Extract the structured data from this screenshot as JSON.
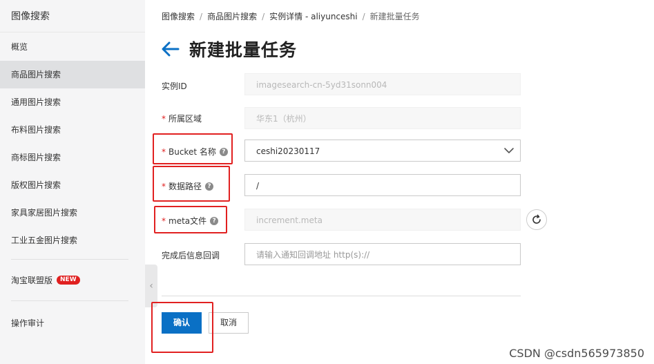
{
  "sidebar": {
    "title": "图像搜索",
    "items": [
      {
        "label": "概览"
      },
      {
        "label": "商品图片搜索"
      },
      {
        "label": "通用图片搜索"
      },
      {
        "label": "布料图片搜索"
      },
      {
        "label": "商标图片搜索"
      },
      {
        "label": "版权图片搜索"
      },
      {
        "label": "家具家居图片搜索"
      },
      {
        "label": "工业五金图片搜索"
      }
    ],
    "taobao": {
      "label": "淘宝联盟版",
      "badge": "NEW"
    },
    "audit": {
      "label": "操作审计"
    },
    "collapse_glyph": "‹"
  },
  "breadcrumb": {
    "items": [
      "图像搜索",
      "商品图片搜索",
      "实例详情 - aliyunceshi",
      "新建批量任务"
    ],
    "separator": "/"
  },
  "page": {
    "title": "新建批量任务"
  },
  "form": {
    "required_mark": "*",
    "help_glyph": "?",
    "instance_id": {
      "label": "实例ID",
      "value": "imagesearch-cn-5yd31sonn004"
    },
    "region": {
      "label": "所属区域",
      "value": "华东1（杭州）"
    },
    "bucket": {
      "label": "Bucket 名称",
      "value": "ceshi20230117"
    },
    "data_path": {
      "label": "数据路径",
      "value": "/"
    },
    "meta_file": {
      "label": "meta文件",
      "value": "increment.meta"
    },
    "callback": {
      "label": "完成后信息回调",
      "placeholder": "请输入通知回调地址 http(s)://"
    }
  },
  "buttons": {
    "confirm": "确认",
    "cancel": "取消"
  },
  "watermark": "CSDN @csdn565973850",
  "colors": {
    "primary": "#0a70c5",
    "highlight": "#e12020",
    "required": "#e02020"
  }
}
